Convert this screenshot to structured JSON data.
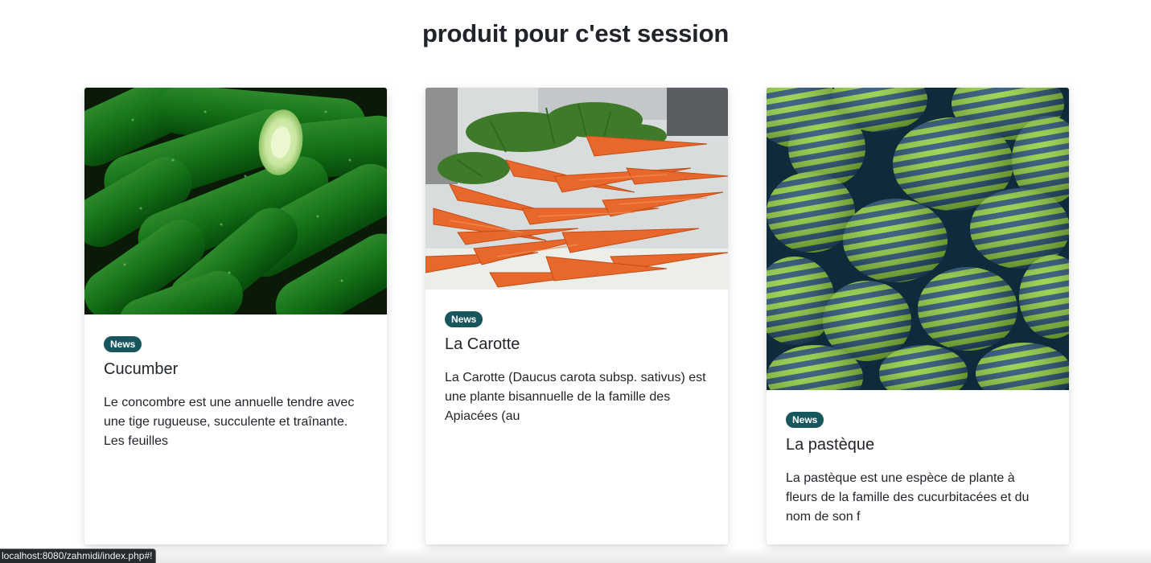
{
  "page": {
    "title": "produit pour c'est session"
  },
  "cards": [
    {
      "badge": "News",
      "title": "Cucumber",
      "text": "Le concombre est une annuelle tendre avec une tige rugueuse, succulente et traînante. Les feuilles",
      "image_icon": "cucumber-image"
    },
    {
      "badge": "News",
      "title": "La Carotte",
      "text": "La Carotte (Daucus carota subsp. sativus) est une plante bisannuelle de la famille des Apiacées (au",
      "image_icon": "carrot-image"
    },
    {
      "badge": "News",
      "title": "La pastèque",
      "text": "La pastèque est une espèce de plante à fleurs de la famille des cucurbitacées et du nom de son f",
      "image_icon": "watermelon-image"
    }
  ],
  "statusbar": {
    "url": "localhost:8080/zahmidi/index.php#!"
  },
  "colors": {
    "badge": "#18565d",
    "text": "#212529",
    "background": "#ffffff"
  }
}
